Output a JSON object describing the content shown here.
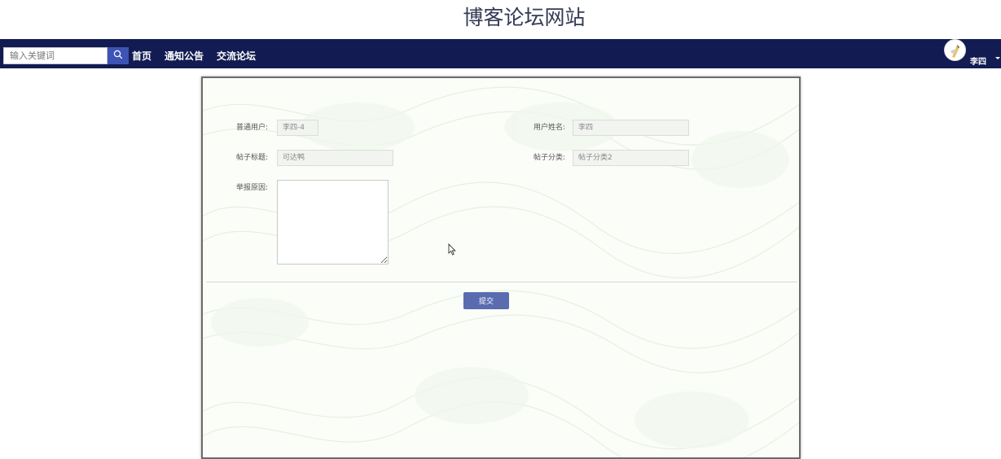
{
  "site": {
    "title": "博客论坛网站"
  },
  "navbar": {
    "search_placeholder": "输入关键词",
    "links": [
      "首页",
      "通知公告",
      "交流论坛"
    ],
    "user_name": "李四",
    "background_color": "#121c52"
  },
  "form": {
    "user_label": "普通用户:",
    "user_value": "李四-4",
    "name_label": "用户姓名:",
    "name_value": "李四",
    "title_label": "帖子标题:",
    "title_value": "可达鸭",
    "category_label": "帖子分类:",
    "category_value": "帖子分类2",
    "reason_label": "举报原因:",
    "reason_value": "",
    "submit_label": "提交"
  },
  "icons": {
    "search": "search-icon",
    "avatar": "avatar",
    "caret": "chevron-down-icon",
    "cursor": "mouse-cursor-icon"
  }
}
